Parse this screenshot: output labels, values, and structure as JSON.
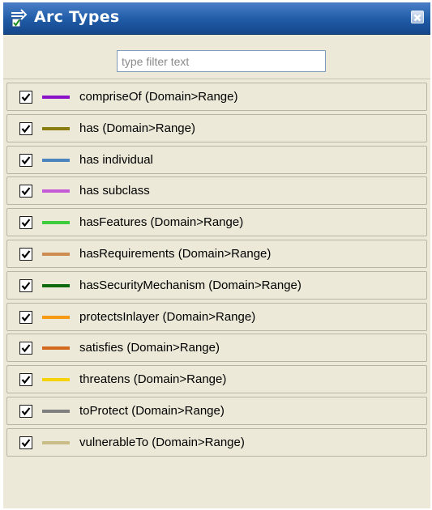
{
  "panel": {
    "title": "Arc Types",
    "icon": "arc-types-icon",
    "close_icon": "close-icon"
  },
  "filter": {
    "placeholder": "type filter text",
    "value": ""
  },
  "arc_types": [
    {
      "label": "compriseOf (Domain>Range)",
      "color": "#8b12c8",
      "checked": true
    },
    {
      "label": "has (Domain>Range)",
      "color": "#8a7d10",
      "checked": true
    },
    {
      "label": "has individual",
      "color": "#4c84be",
      "checked": true
    },
    {
      "label": "has subclass",
      "color": "#c45ad6",
      "checked": true
    },
    {
      "label": "hasFeatures (Domain>Range)",
      "color": "#3ccc3c",
      "checked": true
    },
    {
      "label": "hasRequirements (Domain>Range)",
      "color": "#cd8c52",
      "checked": true
    },
    {
      "label": "hasSecurityMechanism (Domain>Range)",
      "color": "#0d6a0d",
      "checked": true
    },
    {
      "label": "protectsInlayer (Domain>Range)",
      "color": "#f79a16",
      "checked": true
    },
    {
      "label": "satisfies (Domain>Range)",
      "color": "#d2691e",
      "checked": true
    },
    {
      "label": "threatens (Domain>Range)",
      "color": "#f5d20a",
      "checked": true
    },
    {
      "label": "toProtect (Domain>Range)",
      "color": "#7f7f7f",
      "checked": true
    },
    {
      "label": "vulnerableTo (Domain>Range)",
      "color": "#c8bd86",
      "checked": true
    }
  ]
}
